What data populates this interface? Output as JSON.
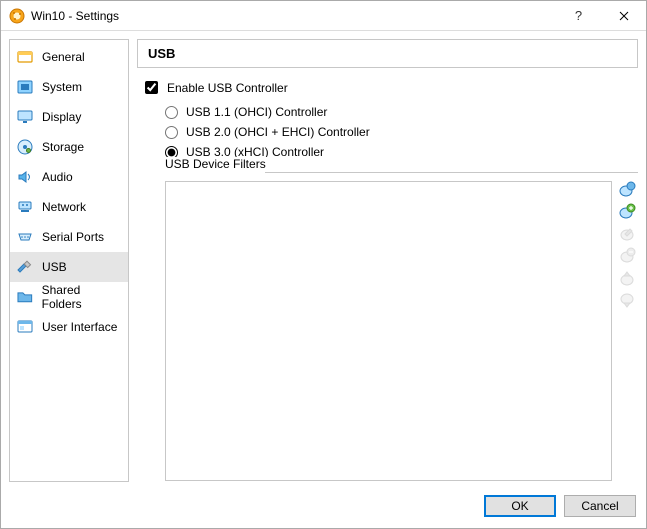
{
  "window": {
    "title": "Win10 - Settings"
  },
  "sidebar": {
    "items": [
      {
        "label": "General"
      },
      {
        "label": "System"
      },
      {
        "label": "Display"
      },
      {
        "label": "Storage"
      },
      {
        "label": "Audio"
      },
      {
        "label": "Network"
      },
      {
        "label": "Serial Ports"
      },
      {
        "label": "USB"
      },
      {
        "label": "Shared Folders"
      },
      {
        "label": "User Interface"
      }
    ]
  },
  "panel": {
    "header": "USB",
    "enable_label": "Enable USB Controller",
    "radios": {
      "r1": "USB 1.1 (OHCI) Controller",
      "r2": "USB 2.0 (OHCI + EHCI) Controller",
      "r3": "USB 3.0 (xHCI) Controller"
    },
    "filters_label": "USB Device Filters"
  },
  "footer": {
    "ok": "OK",
    "cancel": "Cancel"
  }
}
